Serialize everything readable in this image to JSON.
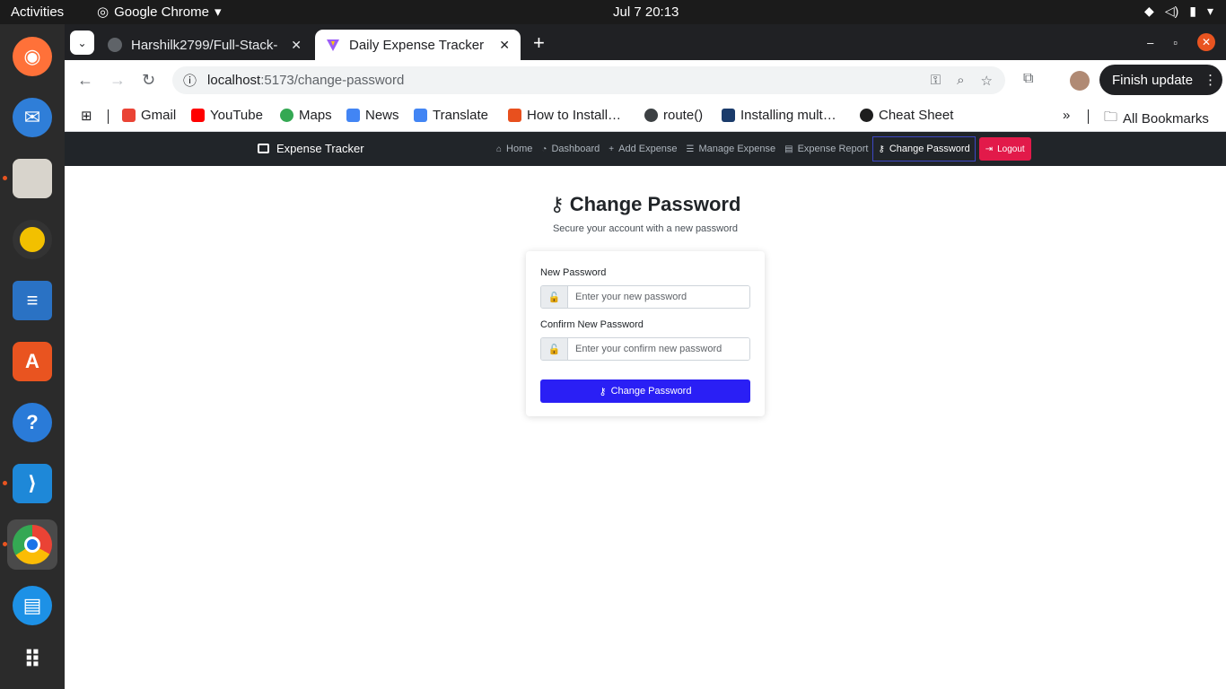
{
  "os": {
    "activities": "Activities",
    "app_name": "Google Chrome",
    "clock": "Jul 7  20:13"
  },
  "browser": {
    "tabs": [
      {
        "title": "Harshilk2799/Full-Stack-"
      },
      {
        "title": "Daily Expense Tracker"
      }
    ],
    "url_host": "localhost",
    "url_path": ":5173/change-password",
    "finish_update": "Finish update",
    "bookmarks": [
      {
        "label": "Gmail"
      },
      {
        "label": "YouTube"
      },
      {
        "label": "Maps"
      },
      {
        "label": "News"
      },
      {
        "label": "Translate"
      },
      {
        "label": "How to Install…"
      },
      {
        "label": "route()"
      },
      {
        "label": "Installing mult…"
      },
      {
        "label": "Cheat Sheet"
      }
    ],
    "all_bookmarks": "All Bookmarks"
  },
  "app": {
    "brand": "Expense Tracker",
    "nav": [
      {
        "label": "Home"
      },
      {
        "label": "Dashboard"
      },
      {
        "label": "Add Expense"
      },
      {
        "label": "Manage Expense"
      },
      {
        "label": "Expense Report"
      },
      {
        "label": "Change Password"
      }
    ],
    "logout": "Logout",
    "title": "Change Password",
    "subtitle": "Secure your account with a new password",
    "form": {
      "new_label": "New Password",
      "new_placeholder": "Enter your new password",
      "confirm_label": "Confirm New Password",
      "confirm_placeholder": "Enter your confirm new password",
      "submit": "Change Password"
    }
  },
  "colors": {
    "navbar": "#212529",
    "logout": "#e21a4a",
    "submit": "#2a1ff5",
    "os_accent": "#e95420"
  }
}
